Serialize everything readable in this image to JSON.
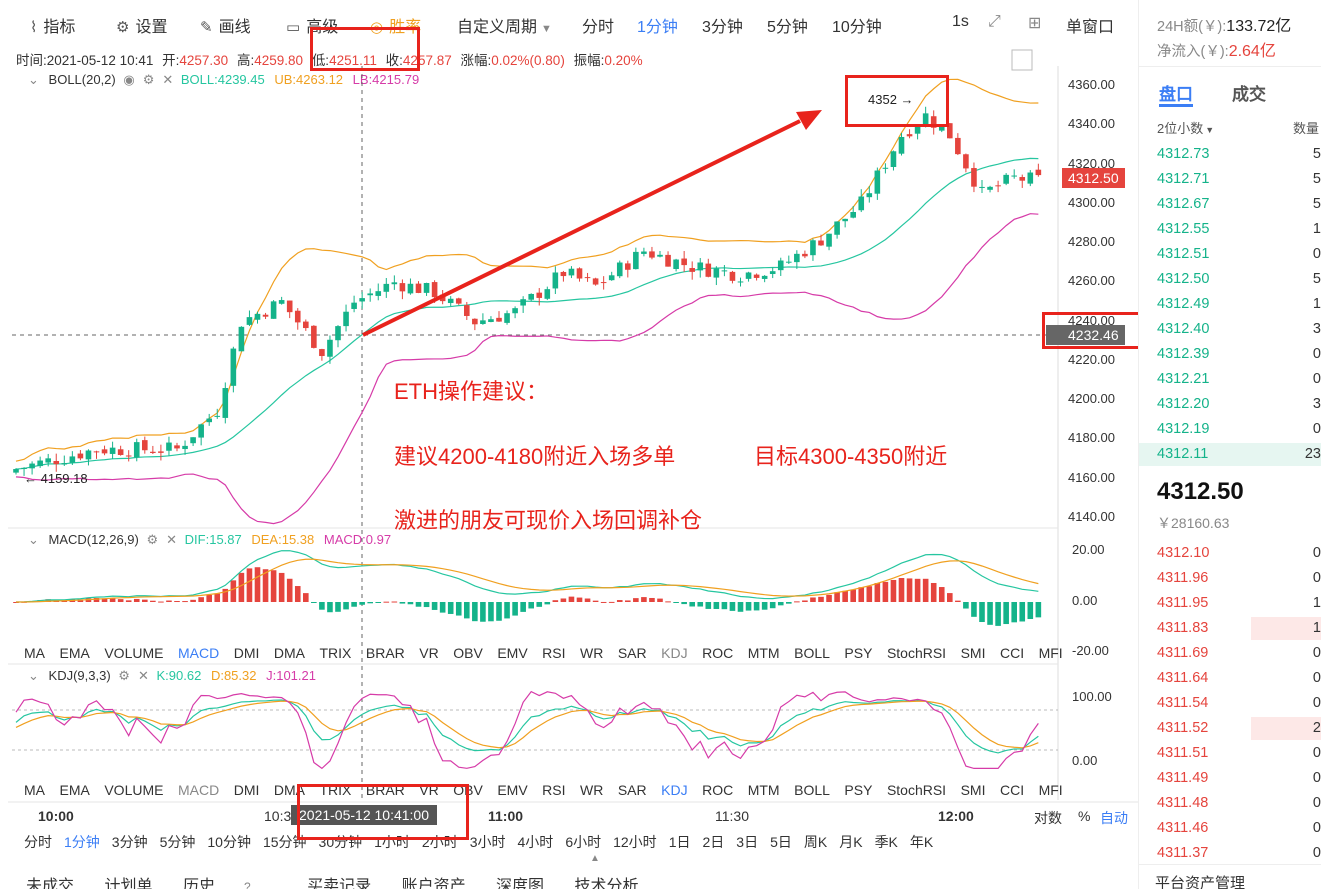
{
  "toolbar": {
    "items": [
      {
        "label": "指标",
        "icon": "chart-icon"
      },
      {
        "label": "设置",
        "icon": "gear-icon"
      },
      {
        "label": "画线",
        "icon": "pen-icon"
      },
      {
        "label": "高级",
        "icon": "briefcase-icon"
      },
      {
        "label": "胜率",
        "icon": "rate-icon"
      }
    ],
    "custom_period": "自定义周期",
    "periods": [
      "分时",
      "1分钟",
      "3分钟",
      "5分钟",
      "10分钟"
    ],
    "active_period": "1分钟",
    "interval": "1s",
    "window_mode": "单窗口"
  },
  "info_bar": {
    "time_label": "时间:",
    "time": "2021-05-12 10:41",
    "open_label": "开:",
    "open": "4257.30",
    "high_label": "高:",
    "high": "4259.80",
    "low_label": "低:",
    "low": "4251.11",
    "close_label": "收:",
    "close": "4257.87",
    "change_label": "涨幅:",
    "change": "0.02%(0.80)",
    "amp_label": "振幅:",
    "amp": "0.20%"
  },
  "boll": {
    "title": "BOLL(20,2)",
    "boll": "BOLL:4239.45",
    "ub": "UB:4263.12",
    "lb": "LB:4215.79"
  },
  "macd": {
    "title": "MACD(12,26,9)",
    "dif": "DIF:15.87",
    "dea": "DEA:15.38",
    "macd": "MACD:0.97"
  },
  "kdj": {
    "title": "KDJ(9,3,3)",
    "k": "K:90.62",
    "d": "D:85.32",
    "j": "J:101.21"
  },
  "main_y_labels": [
    "4360.00",
    "4340.00",
    "4320.00",
    "4300.00",
    "4280.00",
    "4260.00",
    "4240.00",
    "4220.00",
    "4200.00",
    "4180.00",
    "4160.00",
    "4140.00"
  ],
  "macd_y_labels": [
    "20.00",
    "0.00",
    "-20.00"
  ],
  "kdj_y_labels": [
    "100.00",
    "0.00"
  ],
  "price_tags": {
    "last": "4312.50",
    "crosshair": "4232.46"
  },
  "chart_annotations": {
    "high_mark": "4352 →",
    "low_mark": "← 4159.18"
  },
  "indicator_tabs": [
    "MA",
    "EMA",
    "VOLUME",
    "MACD",
    "DMI",
    "DMA",
    "TRIX",
    "BRAR",
    "VR",
    "OBV",
    "EMV",
    "RSI",
    "WR",
    "SAR",
    "KDJ",
    "ROC",
    "MTM",
    "BOLL",
    "PSY",
    "StochRSI",
    "SMI",
    "CCI",
    "MFI"
  ],
  "x_axis": {
    "labels": [
      "10:00",
      "10:3",
      "11:00",
      "11:30",
      "12:00"
    ],
    "crosshair_time": "2021-05-12 10:41:00",
    "log_label": "对数",
    "pct_label": "%",
    "auto_label": "自动"
  },
  "period_bar": [
    "分时",
    "1分钟",
    "3分钟",
    "5分钟",
    "10分钟",
    "15分钟",
    "30分钟",
    "1小时",
    "2小时",
    "3小时",
    "4小时",
    "6小时",
    "12小时",
    "1日",
    "2日",
    "3日",
    "5日",
    "周K",
    "月K",
    "季K",
    "年K"
  ],
  "bottom_tabs": [
    "未成交",
    "计划单",
    "历史",
    "买卖记录",
    "账户资产",
    "深度图",
    "技术分析"
  ],
  "annotation": {
    "title": "ETH操作建议：",
    "line1": "建议4200-4180附近入场多单",
    "line2": "目标4300-4350附近",
    "line3": "激进的朋友可现价入场回调补仓"
  },
  "right_panel": {
    "vol_label": "24H额(￥):",
    "vol": "133.72亿",
    "inflow_label": "净流入(￥):",
    "inflow": "2.64亿",
    "tab_book": "盘口",
    "tab_trades": "成交",
    "decimals": "2位小数",
    "qty_header": "数量",
    "bids_top": [
      {
        "price": "4312.73",
        "q": "5"
      },
      {
        "price": "4312.71",
        "q": "5"
      },
      {
        "price": "4312.67",
        "q": "5"
      },
      {
        "price": "4312.55",
        "q": "1"
      },
      {
        "price": "4312.51",
        "q": "0"
      },
      {
        "price": "4312.50",
        "q": "5"
      },
      {
        "price": "4312.49",
        "q": "1"
      },
      {
        "price": "4312.40",
        "q": "3"
      },
      {
        "price": "4312.39",
        "q": "0"
      },
      {
        "price": "4312.21",
        "q": "0"
      },
      {
        "price": "4312.20",
        "q": "3"
      },
      {
        "price": "4312.19",
        "q": "0"
      },
      {
        "price": "4312.11",
        "q": "23"
      }
    ],
    "last_price": "4312.50",
    "cny_price": "￥28160.63",
    "asks": [
      {
        "price": "4312.10",
        "q": "0"
      },
      {
        "price": "4311.96",
        "q": "0"
      },
      {
        "price": "4311.95",
        "q": "1"
      },
      {
        "price": "4311.83",
        "q": "1"
      },
      {
        "price": "4311.69",
        "q": "0"
      },
      {
        "price": "4311.64",
        "q": "0"
      },
      {
        "price": "4311.54",
        "q": "0"
      },
      {
        "price": "4311.52",
        "q": "2"
      },
      {
        "price": "4311.51",
        "q": "0"
      },
      {
        "price": "4311.49",
        "q": "0"
      },
      {
        "price": "4311.48",
        "q": "0"
      },
      {
        "price": "4311.46",
        "q": "0"
      },
      {
        "price": "4311.37",
        "q": "0"
      }
    ],
    "footer": "平台资产管理"
  },
  "colors": {
    "up": "#14b38a",
    "down": "#e5443d",
    "accent": "#3b7ef5",
    "annotation": "#e8231c",
    "boll": "#26c6a0",
    "ub": "#f0a020",
    "lb": "#d63ba8"
  }
}
